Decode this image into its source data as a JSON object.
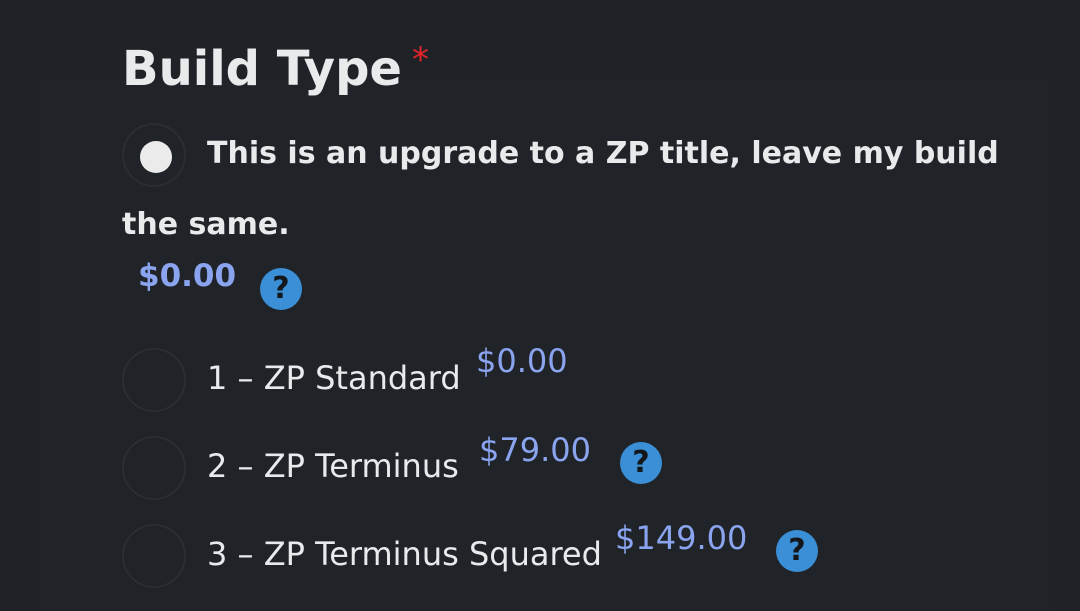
{
  "field": {
    "title": "Build Type",
    "required_marker": "*"
  },
  "options": [
    {
      "label_line1": "This is an upgrade to a ZP title, leave my build",
      "label_line2": "the same.",
      "price": "$0.00",
      "selected": true,
      "has_help": true
    },
    {
      "label": "1 – ZP Standard",
      "price": "$0.00",
      "selected": false,
      "has_help": false
    },
    {
      "label": "2 – ZP Terminus",
      "price": "$79.00",
      "selected": false,
      "has_help": true
    },
    {
      "label": "3 – ZP Terminus Squared",
      "price": "$149.00",
      "selected": false,
      "has_help": true
    }
  ],
  "help_glyph": "?",
  "colors": {
    "background": "#1f2328",
    "price": "#8aa4ef",
    "required": "#e5252a",
    "help_icon": "#3a8fd6"
  }
}
